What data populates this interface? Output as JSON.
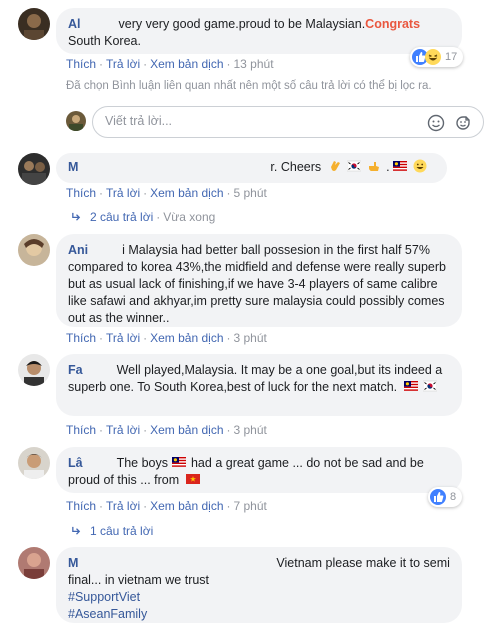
{
  "comments": [
    {
      "name": "Al",
      "text_1": "very very good game.proud to be Malaysian.",
      "highlight": "Congrats",
      "text_2": "South Korea.",
      "actions": [
        "Thích",
        "Trả lời",
        "Xem bản dịch"
      ],
      "time": "13 phút",
      "reaction_count": "17"
    },
    {
      "name": "M",
      "text": "r. Cheers",
      "actions": [
        "Thích",
        "Trả lời",
        "Xem bản dịch"
      ],
      "time": "5 phút",
      "replies_label": "2 câu trả lời",
      "replies_time": "Vừa xong"
    },
    {
      "name": "Ani",
      "text": "i Malaysia had better ball possesion in the first half 57% compared to korea 43%,the midfield and defense were really superb but as usual lack of finishing,if we have 3-4 players of same calibre like safawi and akhyar,im pretty sure malaysia could possibly comes out as the winner..",
      "actions": [
        "Thích",
        "Trả lời",
        "Xem bản dịch"
      ],
      "time": "3 phút"
    },
    {
      "name": "Fa",
      "text": "Well played,Malaysia. It may be a one goal,but its indeed a superb one. To South Korea,best of luck for the next match.",
      "actions": [
        "Thích",
        "Trả lời",
        "Xem bản dịch"
      ],
      "time": "3 phút"
    },
    {
      "name": "Lâ",
      "text_1": "The boys",
      "text_2": "had a great game ... do not be sad and be proud of this ... from",
      "actions": [
        "Thích",
        "Trả lời",
        "Xem bản dịch"
      ],
      "time": "7 phút",
      "reaction_count": "8",
      "replies_label": "1 câu trả lời"
    },
    {
      "name": "M",
      "text": "Vietnam please make it to semi final... in vietnam we trust",
      "tags": [
        "#SupportViet",
        "#AseanFamily"
      ]
    }
  ],
  "filter_notice": "Đã chọn Bình luận liên quan nhất nên một số câu trả lời có thể bị lọc ra.",
  "reply_box": {
    "placeholder": "Viết trả lời..."
  },
  "dot": "·",
  "icons": {
    "reply_arrow": "reply-arrow-icon",
    "emoji": "smiley-icon",
    "sticker": "sticker-icon",
    "like": "like-reaction-icon",
    "haha": "haha-reaction-icon"
  },
  "colors": {
    "link": "#4267b2",
    "name": "#365899",
    "congrats": "#e9573f",
    "bubble": "#f2f3f5",
    "muted": "#90949c"
  }
}
